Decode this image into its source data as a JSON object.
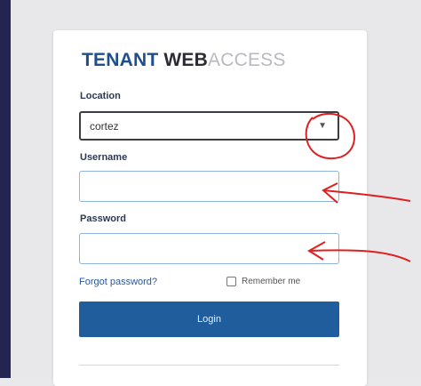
{
  "brand": {
    "tenant": "TENANT",
    "web": "WEB",
    "access": "ACCESS"
  },
  "form": {
    "location_label": "Location",
    "location_value": "cortez",
    "username_label": "Username",
    "password_label": "Password",
    "forgot_label": "Forgot password?",
    "remember_label": "Remember me",
    "login_label": "Login"
  },
  "icons": {
    "dropdown": "chevron-down-icon",
    "checkbox": "checkbox-icon"
  },
  "colors": {
    "brand": "#1e4f8a",
    "button": "#1f5d9c",
    "annotation": "#e02020"
  }
}
